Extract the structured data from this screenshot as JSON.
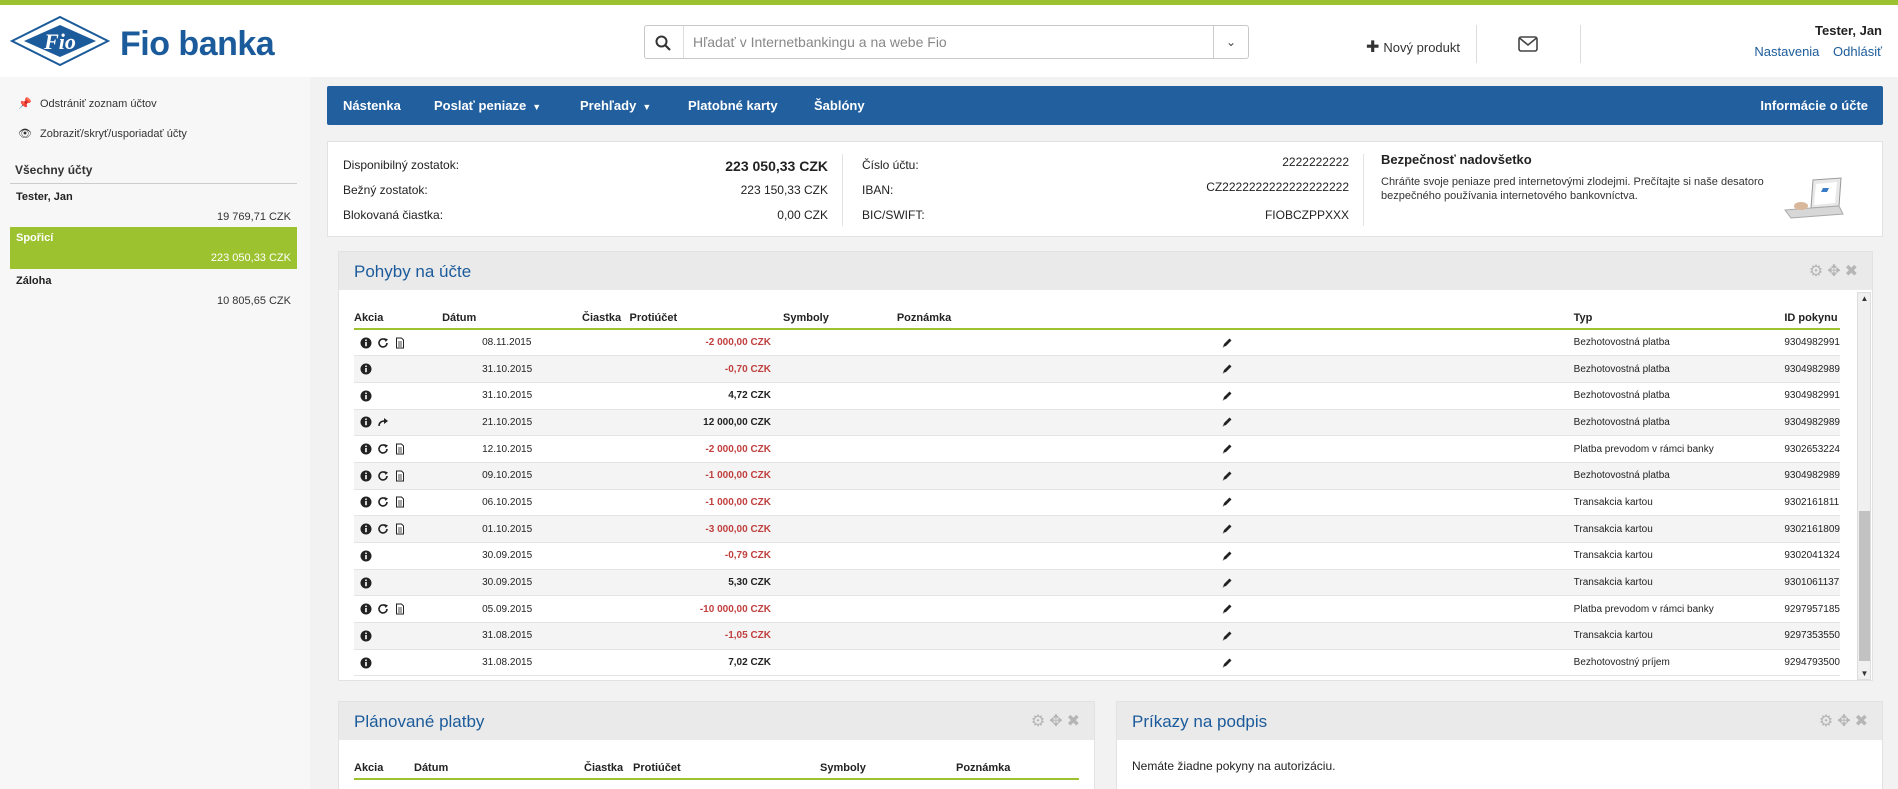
{
  "brand": {
    "name": "Fio banka",
    "logo_text": "Fio"
  },
  "search": {
    "placeholder": "Hľadať v Internetbankingu a na webe Fio"
  },
  "header": {
    "new_product": "Nový produkt",
    "user_name": "Tester, Jan",
    "settings": "Nastavenia",
    "logout": "Odhlásiť"
  },
  "sidebar": {
    "action_remove": "Odstrániť zoznam účtov",
    "action_show": "Zobraziť/skryť/usporiadať účty",
    "all_accounts": "Všechny účty",
    "accounts": [
      {
        "name": "Tester, Jan",
        "balance": "19 769,71 CZK"
      },
      {
        "name": "Spořicí",
        "balance": "223 050,33 CZK"
      },
      {
        "name": "Záloha",
        "balance": "10 805,65 CZK"
      }
    ]
  },
  "nav": {
    "items": [
      "Nástenka",
      "Poslať peniaze",
      "Prehľady",
      "Platobné karty",
      "Šablóny"
    ],
    "right": "Informácie o účte"
  },
  "summary": {
    "available_label": "Disponibilný zostatok:",
    "available_value": "223 050,33 CZK",
    "current_label": "Bežný zostatok:",
    "current_value": "223 150,33 CZK",
    "blocked_label": "Blokovaná čiastka:",
    "blocked_value": "0,00 CZK",
    "account_label": "Číslo účtu:",
    "account_value": "2222222222",
    "iban_label": "IBAN:",
    "iban_value": "CZ2222222222222222222",
    "bic_label": "BIC/SWIFT:",
    "bic_value": "FIOBCZPPXXX",
    "security_title": "Bezpečnosť nadovšetko",
    "security_text": "Chráňte svoje peniaze pred internetovými zlodejmi. Prečítajte si naše desatoro bezpečného používania internetového bankovníctva."
  },
  "movements": {
    "title": "Pohyby na účte",
    "columns": [
      "Akcia",
      "Dátum",
      "Čiastka",
      "Protiúčet",
      "Symboly",
      "Poznámka",
      "Typ",
      "ID pokynu"
    ],
    "rows": [
      {
        "icons": [
          "info",
          "repeat",
          "doc"
        ],
        "date": "08.11.2015",
        "amount": "-2 000,00 CZK",
        "neg": true,
        "type": "Bezhotovostná platba",
        "id": "9304982991"
      },
      {
        "icons": [
          "info"
        ],
        "date": "31.10.2015",
        "amount": "-0,70 CZK",
        "neg": true,
        "type": "Bezhotovostná platba",
        "id": "9304982989"
      },
      {
        "icons": [
          "info"
        ],
        "date": "31.10.2015",
        "amount": "4,72 CZK",
        "neg": false,
        "type": "Bezhotovostná platba",
        "id": "9304982991"
      },
      {
        "icons": [
          "info",
          "forward"
        ],
        "date": "21.10.2015",
        "amount": "12 000,00 CZK",
        "neg": false,
        "type": "Bezhotovostná platba",
        "id": "9304982989"
      },
      {
        "icons": [
          "info",
          "repeat",
          "doc"
        ],
        "date": "12.10.2015",
        "amount": "-2 000,00 CZK",
        "neg": true,
        "type": "Platba prevodom v rámci banky",
        "id": "9302653224"
      },
      {
        "icons": [
          "info",
          "repeat",
          "doc"
        ],
        "date": "09.10.2015",
        "amount": "-1 000,00 CZK",
        "neg": true,
        "type": "Bezhotovostná platba",
        "id": "9304982989"
      },
      {
        "icons": [
          "info",
          "repeat",
          "doc"
        ],
        "date": "06.10.2015",
        "amount": "-1 000,00 CZK",
        "neg": true,
        "type": "Transakcia kartou",
        "id": "9302161811"
      },
      {
        "icons": [
          "info",
          "repeat",
          "doc"
        ],
        "date": "01.10.2015",
        "amount": "-3 000,00 CZK",
        "neg": true,
        "type": "Transakcia kartou",
        "id": "9302161809"
      },
      {
        "icons": [
          "info"
        ],
        "date": "30.09.2015",
        "amount": "-0,79 CZK",
        "neg": true,
        "type": "Transakcia kartou",
        "id": "9302041324"
      },
      {
        "icons": [
          "info"
        ],
        "date": "30.09.2015",
        "amount": "5,30 CZK",
        "neg": false,
        "type": "Transakcia kartou",
        "id": "9301061137"
      },
      {
        "icons": [
          "info",
          "repeat",
          "doc"
        ],
        "date": "05.09.2015",
        "amount": "-10 000,00 CZK",
        "neg": true,
        "type": "Platba prevodom v rámci banky",
        "id": "9297957185"
      },
      {
        "icons": [
          "info"
        ],
        "date": "31.08.2015",
        "amount": "-1,05 CZK",
        "neg": true,
        "type": "Transakcia kartou",
        "id": "9297353550"
      },
      {
        "icons": [
          "info"
        ],
        "date": "31.08.2015",
        "amount": "7,02 CZK",
        "neg": false,
        "type": "Bezhotovostný príjem",
        "id": "9294793500"
      }
    ]
  },
  "planned": {
    "title": "Plánované platby",
    "columns": [
      "Akcia",
      "Dátum",
      "Čiastka",
      "Protiúčet",
      "Symboly",
      "Poznámka"
    ]
  },
  "to_sign": {
    "title": "Príkazy na podpis",
    "empty_text": "Nemáte žiadne pokyny na autorizáciu."
  },
  "colors": {
    "accent_green": "#9dc230",
    "brand_blue": "#215f9e",
    "negative": "#c0403f"
  }
}
